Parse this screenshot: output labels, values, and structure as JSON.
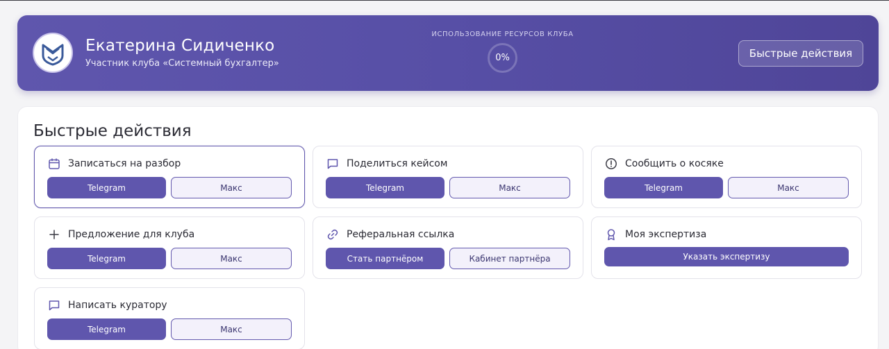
{
  "profile": {
    "name": "Екатерина Сидиченко",
    "role": "Участник клуба «Системный бухгалтер»",
    "avatar_icon": "club-logo-icon"
  },
  "usage": {
    "label": "ИСПОЛЬЗОВАНИЕ РЕСУРСОВ КЛУБА",
    "value": "0%"
  },
  "header": {
    "quick_actions_label": "Быстрые действия"
  },
  "panel": {
    "title": "Быстрые действия"
  },
  "cards": [
    {
      "title": "Записаться на разбор",
      "icon": "calendar-icon",
      "primary": "Telegram",
      "secondary": "Макс"
    },
    {
      "title": "Поделиться кейсом",
      "icon": "chat-icon",
      "primary": "Telegram",
      "secondary": "Макс"
    },
    {
      "title": "Сообщить о косяке",
      "icon": "alert-icon",
      "primary": "Telegram",
      "secondary": "Макс"
    },
    {
      "title": "Предложение для клуба",
      "icon": "plus-icon",
      "primary": "Telegram",
      "secondary": "Макс"
    },
    {
      "title": "Реферальная ссылка",
      "icon": "link-icon",
      "primary": "Стать партнёром",
      "secondary": "Кабинет партнёра"
    },
    {
      "title": "Моя экспертиза",
      "icon": "award-icon",
      "primary": "Указать экспертизу"
    },
    {
      "title": "Написать куратору",
      "icon": "chat-icon",
      "primary": "Telegram",
      "secondary": "Макс"
    }
  ],
  "colors": {
    "accent": "#5f56ad",
    "header_start": "#5f56ad",
    "header_end": "#4f4598",
    "secondary_bg": "#f3f1fb"
  }
}
